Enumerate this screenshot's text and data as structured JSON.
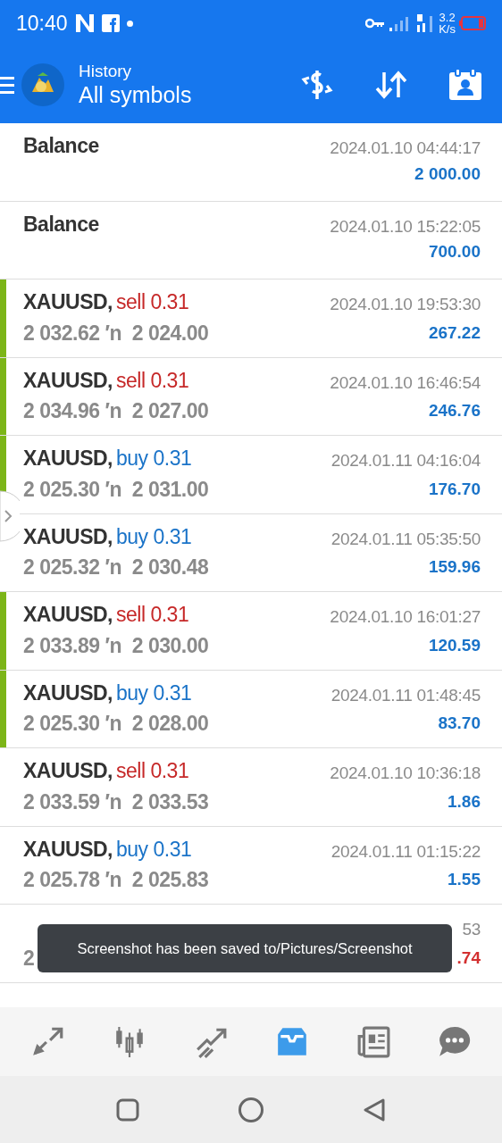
{
  "status_bar": {
    "time": "10:40",
    "speed": "3.2",
    "speed_unit": "K/s"
  },
  "header": {
    "title": "History",
    "subtitle": "All symbols"
  },
  "rows": [
    {
      "kind": "balance",
      "symbol": "Balance",
      "time": "2024.01.10 04:44:17",
      "profit": "2 000.00",
      "loss": false,
      "marked": false
    },
    {
      "kind": "balance",
      "symbol": "Balance",
      "time": "2024.01.10 15:22:05",
      "profit": "700.00",
      "loss": false,
      "marked": false
    },
    {
      "kind": "sell",
      "symbol": "XAUUSD,",
      "action": "sell 0.31",
      "prices": "2 032.62 ′n  2 024.00",
      "time": "2024.01.10 19:53:30",
      "profit": "267.22",
      "loss": false,
      "marked": true
    },
    {
      "kind": "sell",
      "symbol": "XAUUSD,",
      "action": "sell 0.31",
      "prices": "2 034.96 ′n  2 027.00",
      "time": "2024.01.10 16:46:54",
      "profit": "246.76",
      "loss": false,
      "marked": true
    },
    {
      "kind": "buy",
      "symbol": "XAUUSD,",
      "action": "buy 0.31",
      "prices": "2 025.30 ′n  2 031.00",
      "time": "2024.01.11 04:16:04",
      "profit": "176.70",
      "loss": false,
      "marked": true
    },
    {
      "kind": "buy",
      "symbol": "XAUUSD,",
      "action": "buy 0.31",
      "prices": "2 025.32 ′n  2 030.48",
      "time": "2024.01.11 05:35:50",
      "profit": "159.96",
      "loss": false,
      "marked": false
    },
    {
      "kind": "sell",
      "symbol": "XAUUSD,",
      "action": "sell 0.31",
      "prices": "2 033.89 ′n  2 030.00",
      "time": "2024.01.10 16:01:27",
      "profit": "120.59",
      "loss": false,
      "marked": true
    },
    {
      "kind": "buy",
      "symbol": "XAUUSD,",
      "action": "buy 0.31",
      "prices": "2 025.30 ′n  2 028.00",
      "time": "2024.01.11 01:48:45",
      "profit": "83.70",
      "loss": false,
      "marked": true
    },
    {
      "kind": "sell",
      "symbol": "XAUUSD,",
      "action": "sell 0.31",
      "prices": "2 033.59 ′n  2 033.53",
      "time": "2024.01.10 10:36:18",
      "profit": "1.86",
      "loss": false,
      "marked": false
    },
    {
      "kind": "buy",
      "symbol": "XAUUSD,",
      "action": "buy 0.31",
      "prices": "2 025.78 ′n  2 025.83",
      "time": "2024.01.11 01:15:22",
      "profit": "1.55",
      "loss": false,
      "marked": false
    },
    {
      "prices": "2",
      "time": "53",
      "profit": ".74",
      "loss": true,
      "marked": false
    }
  ],
  "toast": "Screenshot has been saved to/Pictures/Screenshot",
  "bottom_tabs": [
    {
      "selected": false
    },
    {
      "selected": false
    },
    {
      "selected": false
    },
    {
      "selected": true
    },
    {
      "selected": false
    },
    {
      "selected": false
    }
  ]
}
